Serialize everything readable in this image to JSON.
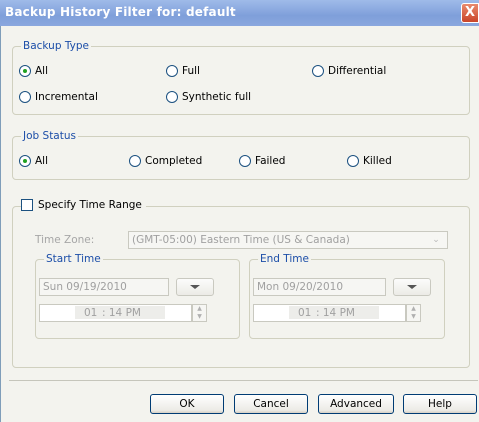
{
  "window": {
    "title": "Backup History Filter for: default",
    "close_glyph": "X"
  },
  "backup_type": {
    "legend": "Backup Type",
    "options": [
      {
        "label": "All",
        "checked": true
      },
      {
        "label": "Full",
        "checked": false
      },
      {
        "label": "Differential",
        "checked": false
      },
      {
        "label": "Incremental",
        "checked": false
      },
      {
        "label": "Synthetic full",
        "checked": false
      }
    ]
  },
  "job_status": {
    "legend": "Job Status",
    "options": [
      {
        "label": "All",
        "checked": true
      },
      {
        "label": "Completed",
        "checked": false
      },
      {
        "label": "Failed",
        "checked": false
      },
      {
        "label": "Killed",
        "checked": false
      }
    ]
  },
  "time_range": {
    "checkbox_label": "Specify Time Range",
    "checked": false,
    "time_zone_label": "Time Zone:",
    "time_zone_value": "(GMT-05:00) Eastern Time (US & Canada)",
    "start": {
      "legend": "Start Time",
      "date": "Sun 09/19/2010",
      "hour": "01",
      "rest": ": 14 PM"
    },
    "end": {
      "legend": "End Time",
      "date": "Mon 09/20/2010",
      "hour": "01",
      "rest": ": 14 PM"
    }
  },
  "buttons": {
    "ok": "OK",
    "cancel": "Cancel",
    "advanced": "Advanced",
    "help": "Help"
  }
}
